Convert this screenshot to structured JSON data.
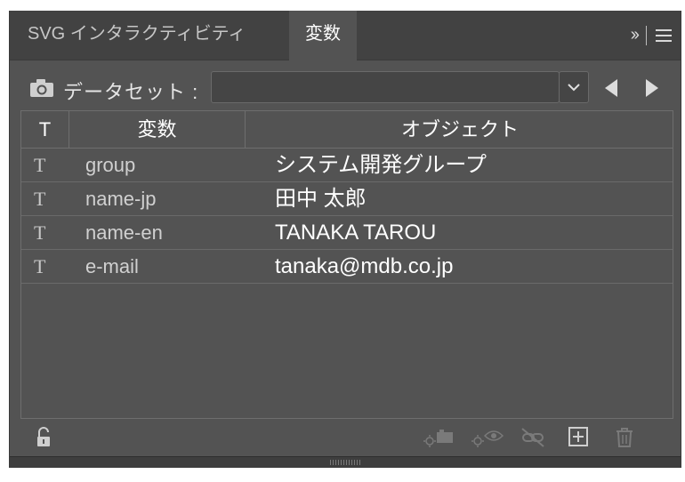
{
  "tabs": [
    {
      "label": "SVG インタラクティビティ",
      "active": false
    },
    {
      "label": "変数",
      "active": true
    }
  ],
  "dataset": {
    "label": "データセット :",
    "selected_value": ""
  },
  "table": {
    "headers": {
      "type": "T",
      "variable": "変数",
      "object": "オブジェクト"
    },
    "rows": [
      {
        "type_icon": "T",
        "variable": "group",
        "object": "システム開発グループ"
      },
      {
        "type_icon": "T",
        "variable": "name-jp",
        "object": "田中 太郎"
      },
      {
        "type_icon": "T",
        "variable": "name-en",
        "object": "TANAKA TAROU"
      },
      {
        "type_icon": "T",
        "variable": "e-mail",
        "object": "tanaka@mdb.co.jp"
      }
    ]
  },
  "icons": {
    "tabbar": [
      "double-chevron-icon",
      "panel-menu-icon"
    ],
    "dataset": [
      "camera-icon",
      "dropdown-chevron-icon",
      "previous-arrow-icon",
      "next-arrow-icon"
    ],
    "bottom": [
      "unlock-icon",
      "bind-object-icon",
      "bind-visibility-icon",
      "unbind-icon",
      "new-variable-icon",
      "trash-icon"
    ]
  },
  "colors": {
    "panel_bg": "#535353",
    "tabbar_bg": "#424242",
    "text_primary": "#ffffff",
    "text_secondary": "#d0d0d0"
  }
}
